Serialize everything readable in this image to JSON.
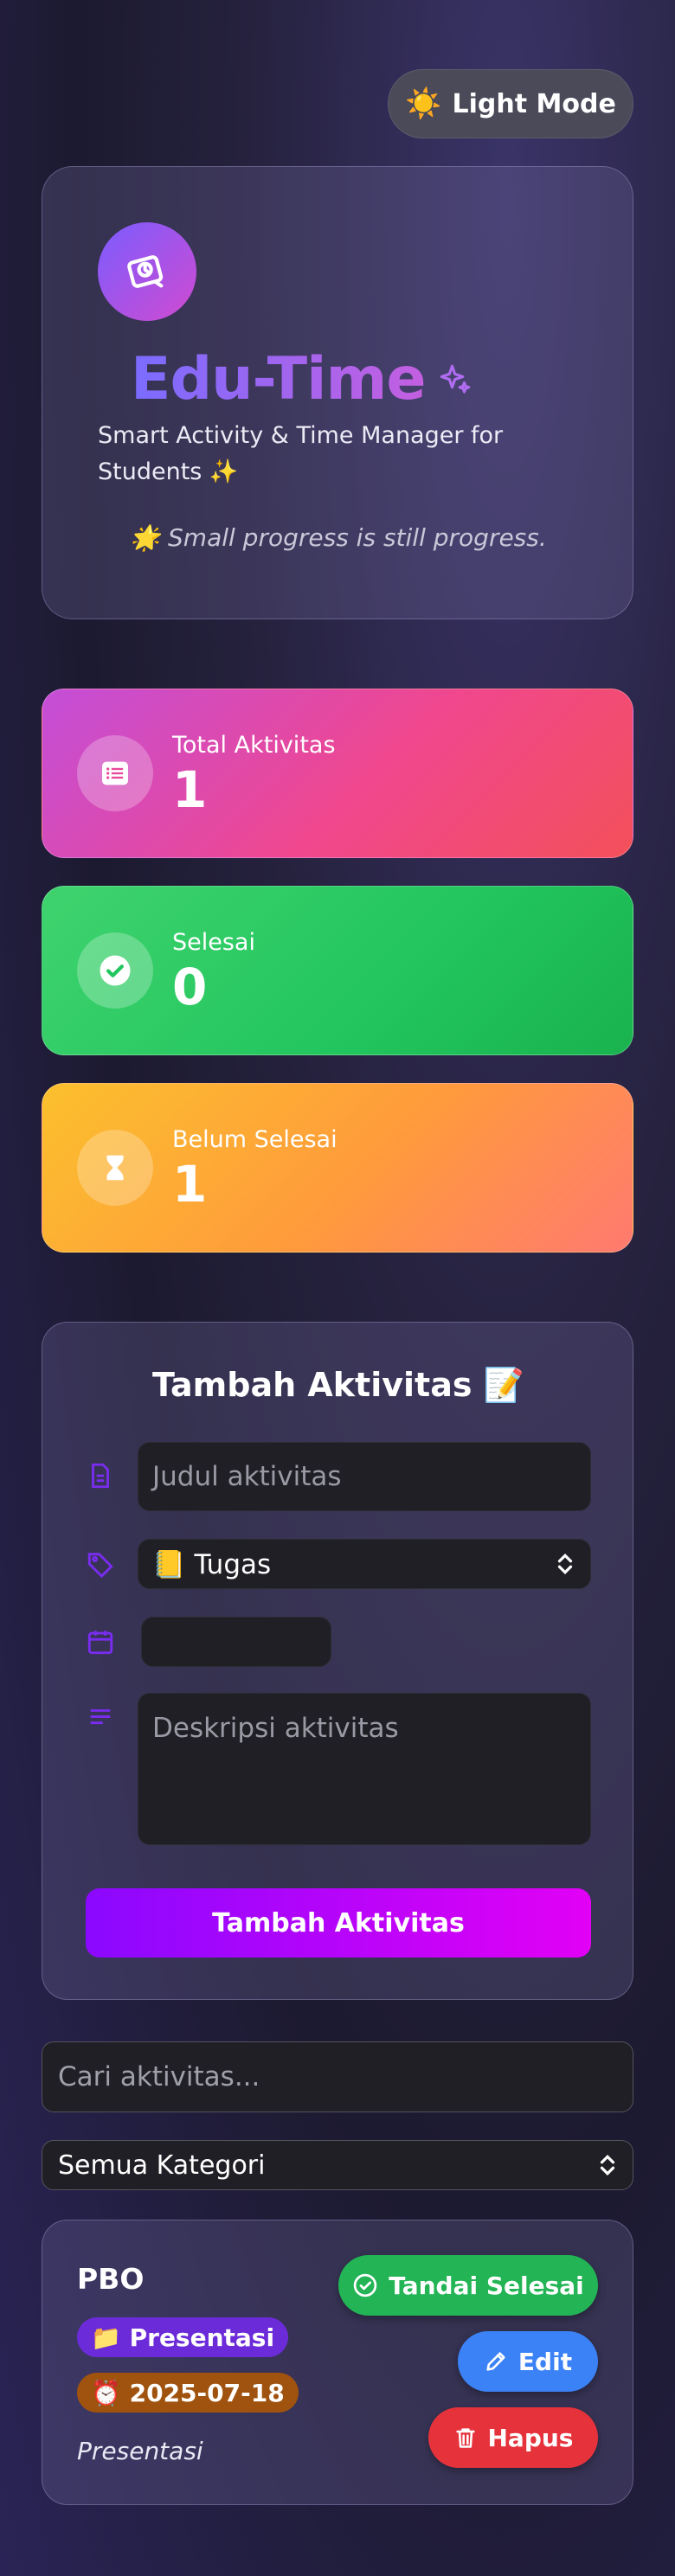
{
  "theme_toggle": {
    "icon": "☀️",
    "label": "Light Mode"
  },
  "header": {
    "brand": "Edu-Time",
    "tagline": "Smart Activity & Time Manager for Students ✨",
    "quote_emoji": "🌟",
    "quote": "Small progress is still progress."
  },
  "stats": {
    "total": {
      "label": "Total Aktivitas",
      "value": "1"
    },
    "done": {
      "label": "Selesai",
      "value": "0"
    },
    "open": {
      "label": "Belum Selesai",
      "value": "1"
    }
  },
  "form": {
    "title": "Tambah Aktivitas 📝",
    "title_placeholder": "Judul aktivitas",
    "category_selected": "📒 Tugas",
    "description_placeholder": "Deskripsi aktivitas",
    "submit_label": "Tambah Aktivitas"
  },
  "search": {
    "placeholder": "Cari aktivitas..."
  },
  "filter": {
    "selected": "Semua Kategori"
  },
  "activities": [
    {
      "title": "PBO",
      "category": "📁 Presentasi",
      "date": "⏰ 2025-07-18",
      "description": "Presentasi",
      "done_label": "Tandai Selesai",
      "edit_label": "Edit",
      "delete_label": "Hapus"
    }
  ],
  "colors": {
    "accent_purple": "#8b08ff",
    "accent_magenta": "#e200f5",
    "success": "#22b455",
    "info": "#3b82f6",
    "danger": "#e5323b"
  }
}
